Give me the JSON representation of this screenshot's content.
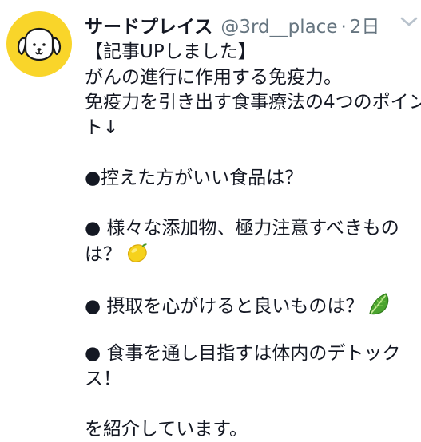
{
  "tweet": {
    "name": "サードプレイス",
    "handle": "@3rd__place",
    "separator": "·",
    "time": "2日",
    "lines": [
      "【記事UPしました】",
      "がんの進行に作用する免疫力。",
      "免疫力を引き出す食事療法の4つのポイン",
      "ト↓",
      "",
      "●控えた方がいい食品は？",
      "",
      "● 様々な添加物、極力注意すべきもの",
      "は？",
      "",
      "● 摂取を心がけると良いものは？",
      "",
      "● 食事を通し目指すは体内のデトック",
      "ス！",
      "",
      "を紹介しています。"
    ],
    "emojis": {
      "line_8": "lemon-emoji-icon",
      "line_10": "leafy-green-emoji-icon"
    },
    "colors": {
      "avatar_bg": "#f9d52a",
      "name": "#141823",
      "meta": "#667580"
    }
  }
}
